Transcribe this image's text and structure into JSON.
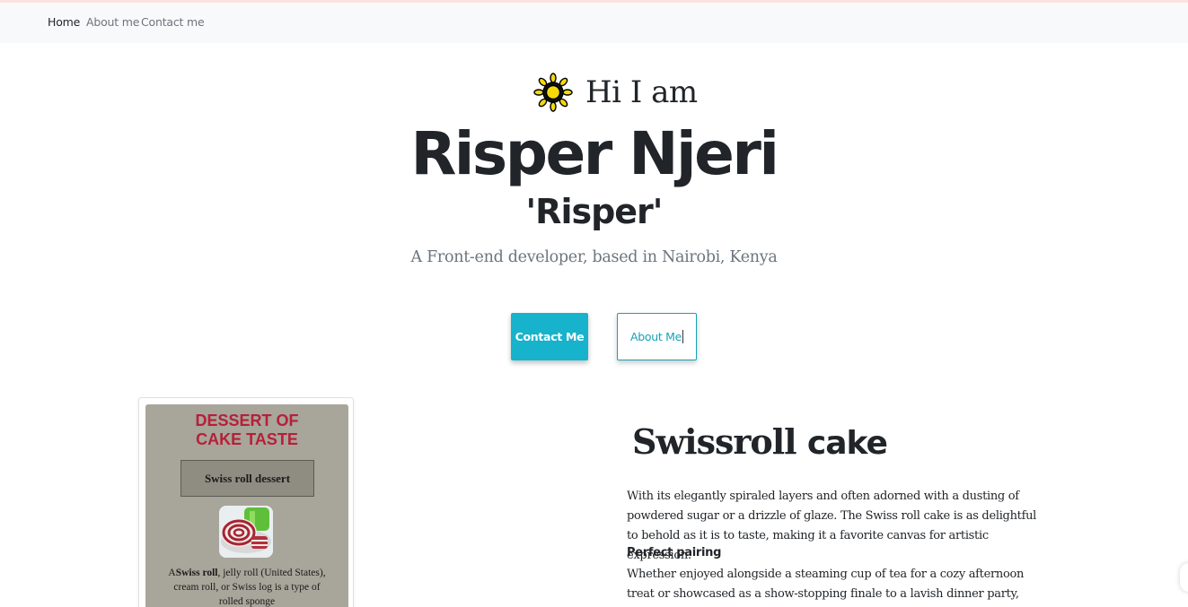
{
  "nav": {
    "items": [
      {
        "label": "Home",
        "active": true
      },
      {
        "label": "About me",
        "active": false
      },
      {
        "label": "Contact me",
        "active": false
      }
    ]
  },
  "hero": {
    "icon": "sun-icon",
    "greeting": "Hi I am",
    "name": "Risper Njeri",
    "nickname": "'Risper'",
    "subtitle": "A Front-end developer, based in Nairobi, Kenya",
    "contact_button": "Contact Me",
    "about_button": "About Me"
  },
  "card": {
    "poster_title_line1": "DESSERT OF",
    "poster_title_line2": "CAKE TASTE",
    "poster_box": "Swiss roll dessert",
    "poster_text_a": "A",
    "poster_text_b": "Swiss roll",
    "poster_text_c": ", jelly roll (United States), cream roll, or Swiss log is a type of rolled sponge"
  },
  "section": {
    "title_light": "Swissroll",
    "title_bold": "cake",
    "paragraph1": "With its elegantly spiraled layers and often adorned with a dusting of powdered sugar or a drizzle of glaze. The Swiss roll cake is as delightful to behold as it is to taste, making it a favorite canvas for artistic expression.",
    "heading2": "Perfect pairing",
    "paragraph2": "Whether enjoyed alongside a steaming cup of tea for a cozy afternoon treat or showcased as a show-stopping finale to a lavish dinner party, Swiss roll cake is a"
  },
  "colors": {
    "accent": "#17b2cc",
    "navbar_bg": "#f8f9fa",
    "poster_bg": "#a8a59a",
    "poster_title": "#b5203a"
  }
}
